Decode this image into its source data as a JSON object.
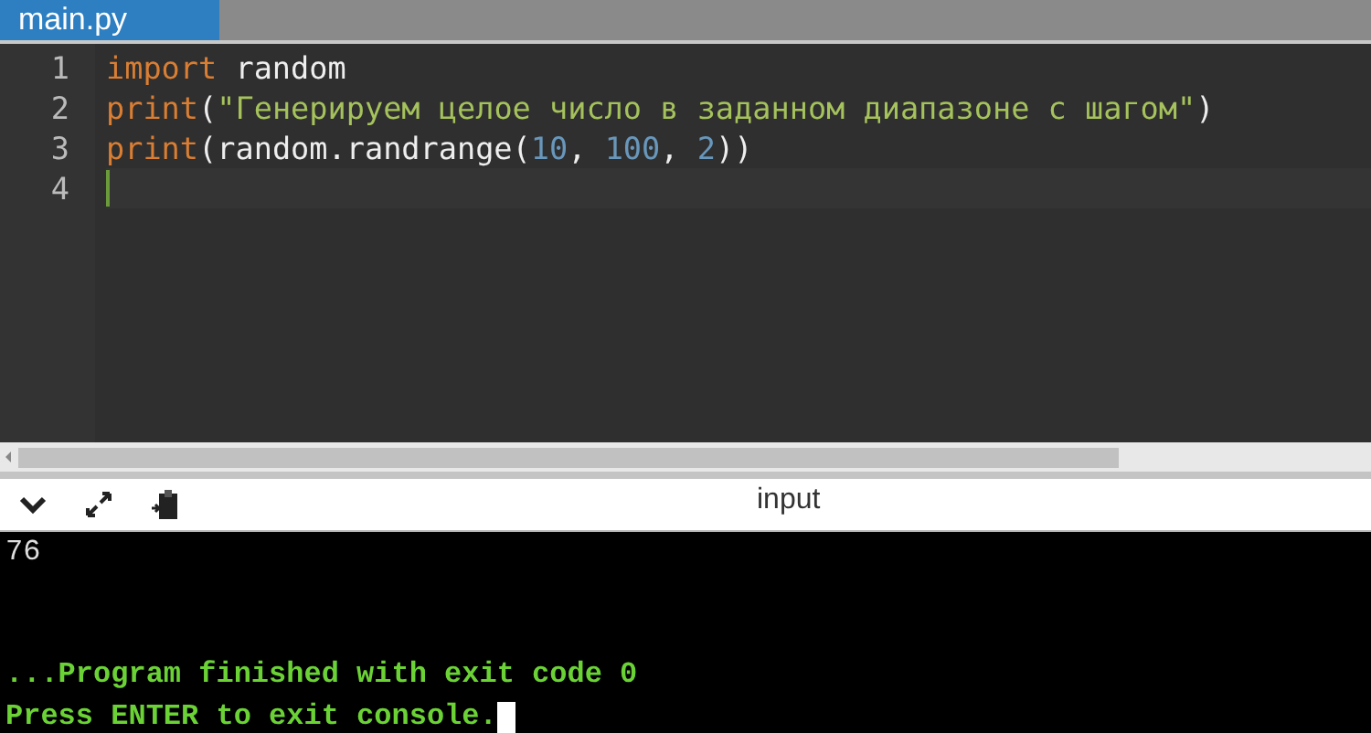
{
  "tabs": [
    {
      "label": "main.py",
      "selected": true
    }
  ],
  "editor": {
    "lines": [
      {
        "number": "1",
        "active": false,
        "tokens": [
          {
            "kind": "keyword",
            "text": "import"
          },
          {
            "kind": "plain",
            "text": " random"
          }
        ]
      },
      {
        "number": "2",
        "active": false,
        "tokens": [
          {
            "kind": "keyword",
            "text": "print"
          },
          {
            "kind": "plain",
            "text": "("
          },
          {
            "kind": "string",
            "text": "\"Генерируем целое число в заданном диапазоне с шагом\""
          },
          {
            "kind": "plain",
            "text": ")"
          }
        ]
      },
      {
        "number": "3",
        "active": false,
        "tokens": [
          {
            "kind": "keyword",
            "text": "print"
          },
          {
            "kind": "plain",
            "text": "(random.randrange("
          },
          {
            "kind": "number",
            "text": "10"
          },
          {
            "kind": "plain",
            "text": ", "
          },
          {
            "kind": "number",
            "text": "100"
          },
          {
            "kind": "plain",
            "text": ", "
          },
          {
            "kind": "number",
            "text": "2"
          },
          {
            "kind": "plain",
            "text": "))"
          }
        ]
      },
      {
        "number": "4",
        "active": true
      }
    ]
  },
  "console": {
    "title": "input",
    "lines": [
      {
        "kind": "output",
        "text": "76"
      },
      {
        "kind": "status",
        "text": "...Program finished with exit code 0"
      },
      {
        "kind": "prompt",
        "text": "Press ENTER to exit console."
      }
    ]
  }
}
